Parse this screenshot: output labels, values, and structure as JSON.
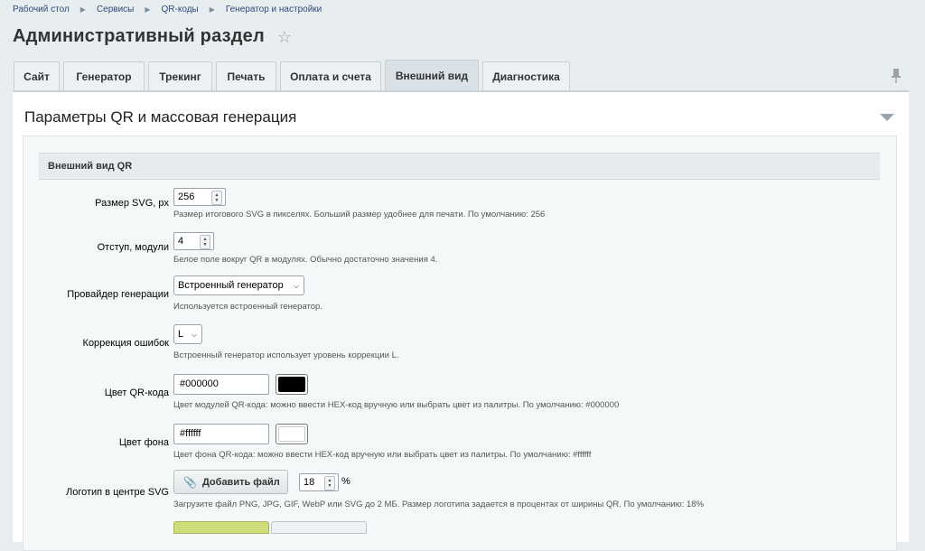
{
  "breadcrumb": [
    "Рабочий стол",
    "Сервисы",
    "QR-коды",
    "Генератор и настройки"
  ],
  "page_title": "Административный раздел",
  "tabs": [
    {
      "label": "Сайт",
      "active": false
    },
    {
      "label": "Генератор",
      "active": false
    },
    {
      "label": "Трекинг",
      "active": false
    },
    {
      "label": "Печать",
      "active": false
    },
    {
      "label": "Оплата и счета",
      "active": false
    },
    {
      "label": "Внешний вид",
      "active": true
    },
    {
      "label": "Диагностика",
      "active": false
    }
  ],
  "panel": {
    "title": "Параметры QR и массовая генерация",
    "section": "Внешний вид QR"
  },
  "fields": {
    "svg_size": {
      "label": "Размер SVG, px",
      "value": "256",
      "hint": "Размер итогового SVG в пикселях. Больший размер удобнее для печати. По умолчанию: 256"
    },
    "margin": {
      "label": "Отступ, модули",
      "value": "4",
      "hint": "Белое поле вокруг QR в модулях. Обычно достаточно значения 4."
    },
    "provider": {
      "label": "Провайдер генерации",
      "value": "Встроенный генератор",
      "hint": "Используется встроенный генератор."
    },
    "correction": {
      "label": "Коррекция ошибок",
      "value": "L",
      "hint": "Встроенный генератор использует уровень коррекции L."
    },
    "qr_color": {
      "label": "Цвет QR-кода",
      "value": "#000000",
      "swatch": "#000000",
      "hint": "Цвет модулей QR-кода: можно ввести HEX-код вручную или выбрать цвет из палитры. По умолчанию: #000000"
    },
    "bg_color": {
      "label": "Цвет фона",
      "value": "#ffffff",
      "swatch": "#ffffff",
      "hint": "Цвет фона QR-кода: можно ввести HEX-код вручную или выбрать цвет из палитры. По умолчанию: #ffffff"
    },
    "logo": {
      "label": "Логотип в центре SVG",
      "button": "Добавить файл",
      "percent": "18",
      "percent_unit": "%",
      "hint": "Загрузите файл PNG, JPG, GIF, WebP или SVG до 2 МБ. Размер логотипа задается в процентах от ширины QR. По умолчанию: 18%"
    }
  },
  "icons": {
    "star": "star-icon",
    "pin": "pin-icon",
    "collapse": "collapse-icon",
    "clip": "paperclip-icon"
  }
}
